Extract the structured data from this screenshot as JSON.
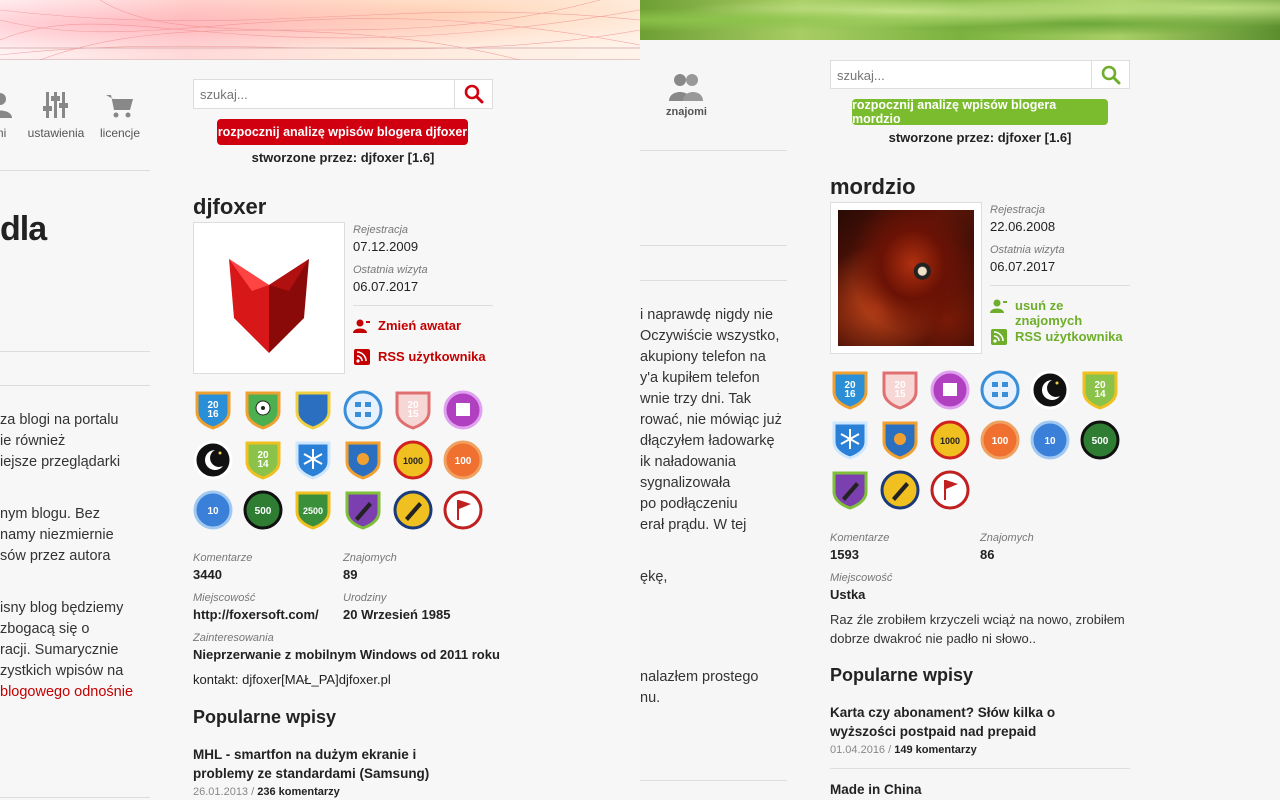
{
  "left": {
    "nav": [
      {
        "label": "mi",
        "icon": "user-icon"
      },
      {
        "label": "ustawienia",
        "icon": "sliders-icon"
      },
      {
        "label": "licencje",
        "icon": "cart-icon"
      }
    ],
    "article_title_fragment": "dla",
    "paragraphs": [
      [
        "za blogi na portalu",
        "ie również",
        "iejsze przeglądarki"
      ],
      [
        "nym blogu. Bez",
        "namy niezmiernie",
        "sów przez autora"
      ],
      [
        "isny blog będziemy",
        "zbogacą się o",
        "racji. Sumarycznie",
        "zystkich wpisów na"
      ]
    ],
    "article_link": "blogowego odnośnie",
    "search_placeholder": "szukaj...",
    "analyze_button": "rozpocznij analizę wpisów blogera djfoxer",
    "created_by": "stworzone przez: djfoxer [1.6]",
    "username": "djfoxer",
    "registration_label": "Rejestracja",
    "registration_value": "07.12.2009",
    "last_visit_label": "Ostatnia wizyta",
    "last_visit_value": "06.07.2017",
    "change_avatar": "Zmień awatar",
    "rss": "RSS użytkownika",
    "stats": {
      "comments_label": "Komentarze",
      "comments_value": "3440",
      "friends_label": "Znajomych",
      "friends_value": "89",
      "location_label": "Miejscowość",
      "location_value": "http://foxersoft.com/",
      "birthday_label": "Urodziny",
      "birthday_value": "20 Wrzesień 1985",
      "interests_label": "Zainteresowania",
      "interests_value": "Nieprzerwanie z mobilnym Windows od 2011 roku",
      "contact": "kontakt: djfoxer[MAŁ_PA]djfoxer.pl"
    },
    "badges": [
      {
        "icon": "year-2016-badge-icon",
        "text": "20\n16"
      },
      {
        "icon": "football-badge-icon",
        "text": ""
      },
      {
        "icon": "winner-badge-icon",
        "text": ""
      },
      {
        "icon": "network-badge-icon",
        "text": ""
      },
      {
        "icon": "year-2015-badge-icon",
        "text": "20\n15"
      },
      {
        "icon": "calendar-badge-icon",
        "text": ""
      },
      {
        "icon": "night-badge-icon",
        "text": ""
      },
      {
        "icon": "year-2014-badge-icon",
        "text": "20\n14"
      },
      {
        "icon": "snowflake-badge-icon",
        "text": ""
      },
      {
        "icon": "sun-badge-icon",
        "text": ""
      },
      {
        "icon": "count-1000-badge-icon",
        "text": "1000"
      },
      {
        "icon": "count-100-badge-icon",
        "text": "100"
      },
      {
        "icon": "count-10-badge-icon",
        "text": "10"
      },
      {
        "icon": "count-500-badge-icon",
        "text": "500"
      },
      {
        "icon": "count-2500-badge-icon",
        "text": "2500"
      },
      {
        "icon": "star-pen-badge-icon",
        "text": ""
      },
      {
        "icon": "pen-badge-icon",
        "text": ""
      },
      {
        "icon": "flag-badge-icon",
        "text": ""
      }
    ],
    "popular_title": "Popularne wpisy",
    "popular_posts": [
      {
        "title_line1": "MHL - smartfon na dużym ekranie i",
        "title_line2": "problemy ze standardami (Samsung)",
        "date": "26.01.2013",
        "comments": "236 komentarzy"
      }
    ]
  },
  "right": {
    "nav_label": "znajomi",
    "paragraphs": [
      "i naprawdę nigdy nie",
      "Oczywiście wszystko,",
      "akupiony telefon na",
      "y'a kupiłem telefon",
      "wnie trzy dni. Tak",
      "rować, nie mówiąc już",
      "dłączyłem ładowarkę",
      "ik naładowania",
      " sygnalizowała",
      "po podłączeniu",
      "erał prądu. W tej"
    ],
    "paragraphs2": [
      "ękę,"
    ],
    "paragraphs3": [
      "nalazłem prostego",
      "nu."
    ],
    "search_placeholder": "szukaj...",
    "analyze_button": "rozpocznij analizę wpisów blogera mordzio",
    "created_by": "stworzone przez: djfoxer [1.6]",
    "username": "mordzio",
    "registration_label": "Rejestracja",
    "registration_value": "22.06.2008",
    "last_visit_label": "Ostatnia wizyta",
    "last_visit_value": "06.07.2017",
    "remove_friend": "usuń ze znajomych",
    "rss": "RSS użytkownika",
    "stats": {
      "comments_label": "Komentarze",
      "comments_value": "1593",
      "friends_label": "Znajomych",
      "friends_value": "86",
      "location_label": "Miejscowość",
      "location_value": "Ustka"
    },
    "about": "Raz źle zrobiłem krzyczeli wciąż na nowo, zrobiłem dobrze dwakroć nie padło ni słowo..",
    "badges": [
      {
        "icon": "year-2016-badge-icon",
        "text": "20\n16"
      },
      {
        "icon": "year-2015-badge-icon",
        "text": "20\n15"
      },
      {
        "icon": "calendar-badge-icon",
        "text": ""
      },
      {
        "icon": "network-badge-icon",
        "text": ""
      },
      {
        "icon": "night-badge-icon",
        "text": ""
      },
      {
        "icon": "year-2014-badge-icon",
        "text": "20\n14"
      },
      {
        "icon": "snowflake-badge-icon",
        "text": ""
      },
      {
        "icon": "sun-badge-icon",
        "text": ""
      },
      {
        "icon": "count-1000-badge-icon",
        "text": "1000"
      },
      {
        "icon": "count-100-badge-icon",
        "text": "100"
      },
      {
        "icon": "count-10-badge-icon",
        "text": "10"
      },
      {
        "icon": "count-500-badge-icon",
        "text": "500"
      },
      {
        "icon": "star-pen-badge-icon",
        "text": ""
      },
      {
        "icon": "pen-badge-icon",
        "text": ""
      },
      {
        "icon": "flag-badge-icon",
        "text": ""
      }
    ],
    "popular_title": "Popularne wpisy",
    "popular_posts": [
      {
        "title_line1": "Karta czy abonament? Słów kilka o",
        "title_line2": "wyższości postpaid nad prepaid",
        "date": "01.04.2016",
        "comments": "149 komentarzy"
      },
      {
        "title_line1": "Made in China",
        "title_line2": "",
        "date": "",
        "comments": ""
      }
    ]
  },
  "colors": {
    "left_accent": "#d00010",
    "right_accent": "#7bbb2e"
  }
}
